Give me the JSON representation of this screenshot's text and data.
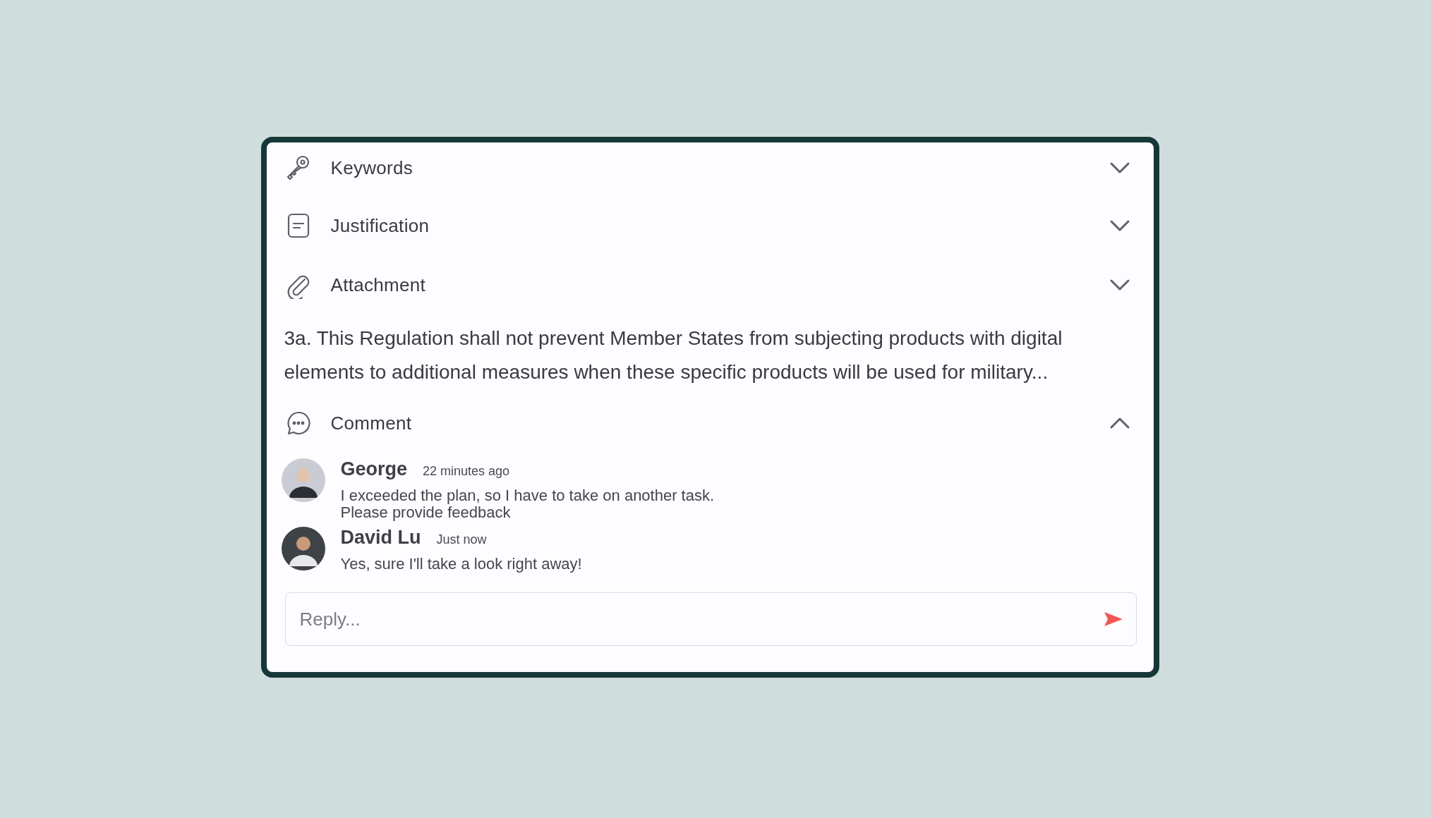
{
  "sections": [
    {
      "kind": "header",
      "label": "Keywords",
      "expanded": false
    },
    {
      "kind": "header",
      "label": "Justification",
      "expanded": false
    },
    {
      "kind": "header",
      "label": "Attachment",
      "expanded": false
    },
    {
      "kind": "text",
      "text": "3a. This Regulation shall not prevent Member States from subjecting products with digital elements to additional measures when these specific products will be used for military..."
    },
    {
      "kind": "header",
      "label": "Comment",
      "expanded": true
    }
  ],
  "comments": [
    {
      "author": "George",
      "time": "22 minutes ago",
      "message": "I exceeded the plan, so I have to take on another task.\nPlease provide feedback"
    },
    {
      "author": "David Lu",
      "time": "Just now",
      "message": "Yes, sure I'll take a look right away!"
    }
  ],
  "reply": {
    "placeholder": "Reply..."
  }
}
